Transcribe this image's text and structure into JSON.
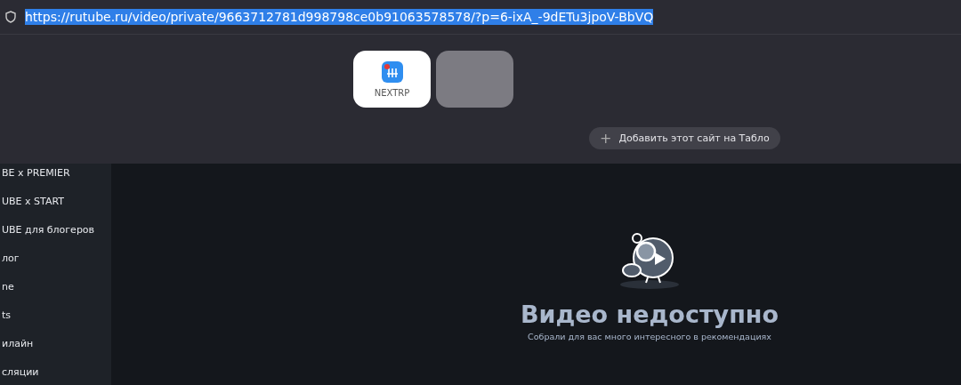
{
  "address_bar": {
    "url": "https://rutube.ru/video/private/9663712781d998798ce0b91063578578/?p=6-ixA_-9dETu3jpoV-BbVQ",
    "selected": true
  },
  "tablo": {
    "tiles": [
      {
        "kind": "site",
        "label": "NEXTRP"
      },
      {
        "kind": "empty"
      }
    ],
    "add_button": {
      "icon": "+",
      "label": "Добавить этот сайт на Табло"
    }
  },
  "sidebar": {
    "items": [
      {
        "label": "BE x PREMIER"
      },
      {
        "label": "UBE x START"
      },
      {
        "label": "UBE для блогеров"
      },
      {
        "label": "лог"
      },
      {
        "label": "ne"
      },
      {
        "label": "ts"
      },
      {
        "label": "илайн"
      },
      {
        "label": "сляции"
      }
    ]
  },
  "message": {
    "title": "Видео недоступно",
    "subtitle": "Собрали для вас много интересного в рекомендациях"
  }
}
